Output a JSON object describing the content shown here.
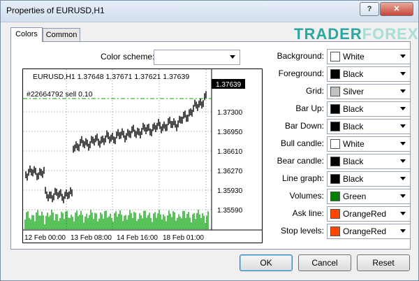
{
  "window": {
    "title": "Properties of EURUSD,H1"
  },
  "titlebar": {
    "help_label": "?",
    "close_label": "✕"
  },
  "tabs": [
    {
      "label": "Colors",
      "active": true
    },
    {
      "label": "Common",
      "active": false
    }
  ],
  "brand": {
    "part1": "TRADER",
    "part2": "FOREX"
  },
  "scheme": {
    "label": "Color scheme:",
    "value": ""
  },
  "chart": {
    "symbol_info": "EURUSD,H1  1.37648 1.37671 1.37621 1.37639",
    "order_info": "#22664792 sell 0.10",
    "current_price": "1.37639",
    "price_labels": [
      "1.37300",
      "1.36950",
      "1.36610",
      "1.36270",
      "1.35930",
      "1.35590"
    ],
    "time_labels": [
      "12 Feb 00:00",
      "13 Feb 08:00",
      "14 Feb 16:00",
      "18 Feb 01:00"
    ]
  },
  "properties": [
    {
      "label": "Background:",
      "value": "White",
      "color": "#ffffff"
    },
    {
      "label": "Foreground:",
      "value": "Black",
      "color": "#000000"
    },
    {
      "label": "Grid:",
      "value": "Silver",
      "color": "#c0c0c0"
    },
    {
      "label": "Bar Up:",
      "value": "Black",
      "color": "#000000"
    },
    {
      "label": "Bar Down:",
      "value": "Black",
      "color": "#000000"
    },
    {
      "label": "Bull candle:",
      "value": "White",
      "color": "#ffffff"
    },
    {
      "label": "Bear candle:",
      "value": "Black",
      "color": "#000000"
    },
    {
      "label": "Line graph:",
      "value": "Black",
      "color": "#000000"
    },
    {
      "label": "Volumes:",
      "value": "Green",
      "color": "#008000"
    },
    {
      "label": "Ask line:",
      "value": "OrangeRed",
      "color": "#ff4500"
    },
    {
      "label": "Stop levels:",
      "value": "OrangeRed",
      "color": "#ff4500"
    }
  ],
  "buttons": {
    "ok": "OK",
    "cancel": "Cancel",
    "reset": "Reset"
  }
}
